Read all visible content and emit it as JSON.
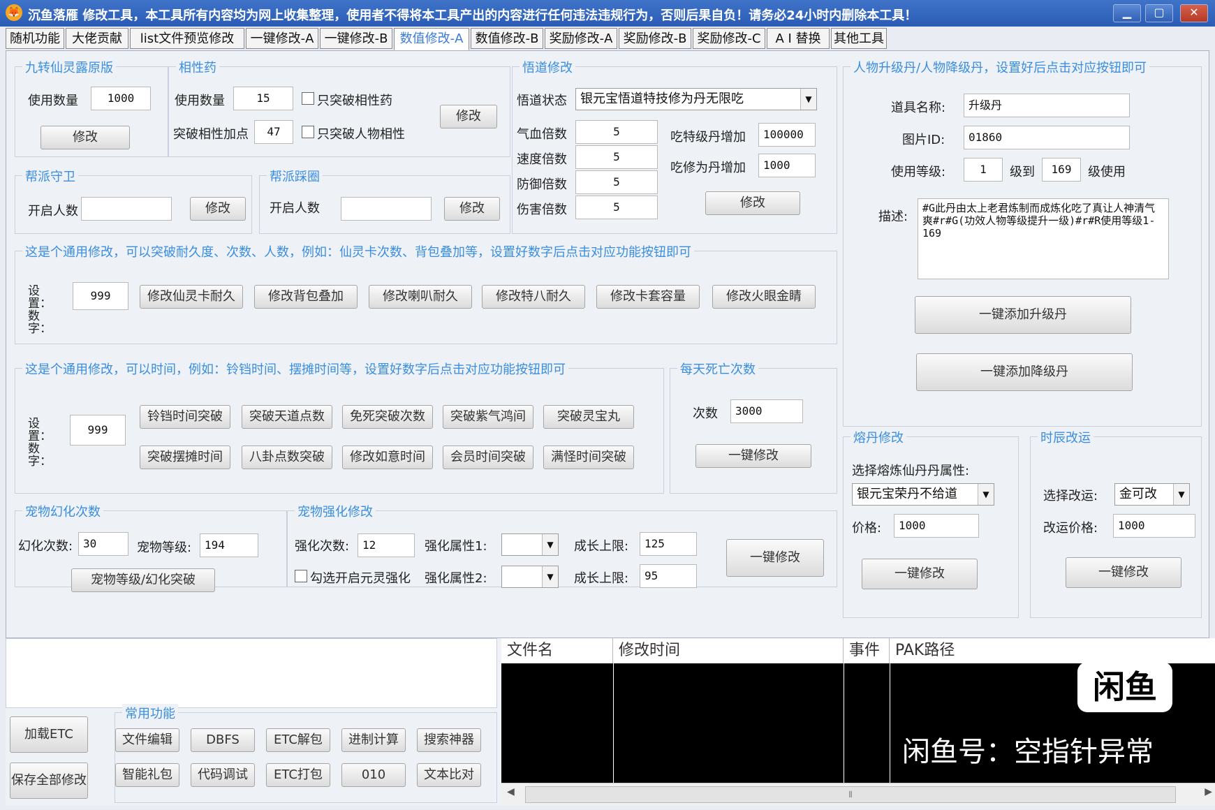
{
  "window": {
    "title": "沉鱼落雁  修改工具，本工具所有内容均为网上收集整理，使用者不得将本工具产出的内容进行任何违法违规行为，否则后果自负！请务必24小时内删除本工具！",
    "min": "▁",
    "max": "▢",
    "close": "✕"
  },
  "tabs": [
    "随机功能",
    "大佬贡献",
    "list文件预览修改",
    "一键修改-A",
    "一键修改-B",
    "数值修改-A",
    "数值修改-B",
    "奖励修改-A",
    "奖励修改-B",
    "奖励修改-C",
    "A I 替换",
    "其他工具"
  ],
  "g1": {
    "title": "九转仙灵露原版",
    "qty_label": "使用数量",
    "qty": "1000",
    "btn": "修改"
  },
  "g2": {
    "title": "相性药",
    "qty_label": "使用数量",
    "qty": "15",
    "chk1": "只突破相性药",
    "bonus_label": "突破相性加点",
    "bonus": "47",
    "chk2": "只突破人物相性",
    "btn": "修改"
  },
  "g3": {
    "title": "帮派守卫",
    "label": "开启人数",
    "value": "",
    "btn": "修改"
  },
  "g4": {
    "title": "帮派踩圈",
    "label": "开启人数",
    "value": "",
    "btn": "修改"
  },
  "g5": {
    "title": "悟道修改",
    "state_label": "悟道状态",
    "state": "银元宝悟道特技修为丹无限吃",
    "hp_label": "气血倍数",
    "hp": "5",
    "speed_label": "速度倍数",
    "speed": "5",
    "def_label": "防御倍数",
    "def": "5",
    "dmg_label": "伤害倍数",
    "dmg": "5",
    "tj_label": "吃特级丹增加",
    "tj": "100000",
    "xw_label": "吃修为丹增加",
    "xw": "1000",
    "btn": "修改"
  },
  "g6": {
    "title": "人物升级丹/人物降级丹，设置好后点击对应按钮即可",
    "name_label": "道具名称:",
    "name": "升级丹",
    "pic_label": "图片ID:",
    "pic": "01860",
    "lvl_label": "使用等级:",
    "lvl_from": "1",
    "to_label": "级到",
    "lvl_to": "169",
    "use_label": "级使用",
    "desc_label": "描述:",
    "desc": "#G此丹由太上老君炼制而成炼化吃了真让人神清气爽#r#G(功效人物等级提升一级)#r#R使用等级1-169",
    "btn_up": "一键添加升级丹",
    "btn_down": "一键添加降级丹"
  },
  "g7": {
    "title": "这是个通用修改，可以突破耐久度、次数、人数，例如：仙灵卡次数、背包叠加等，设置好数字后点击对应功能按钮即可",
    "set_label": "设置：数字：",
    "value": "999",
    "buttons": [
      "修改仙灵卡耐久",
      "修改背包叠加",
      "修改喇叭耐久",
      "修改特八耐久",
      "修改卡套容量",
      "修改火眼金睛"
    ]
  },
  "g8": {
    "title": "这是个通用修改，可以时间，例如：铃铛时间、摆摊时间等，设置好数字后点击对应功能按钮即可",
    "set_label": "设置：数字：",
    "value": "999",
    "buttons": [
      "铃铛时间突破",
      "突破天道点数",
      "免死突破次数",
      "突破紫气鸿间",
      "突破灵宝丸",
      "突破摆摊时间",
      "八卦点数突破",
      "修改如意时间",
      "会员时间突破",
      "满怪时间突破"
    ]
  },
  "g9": {
    "title": "每天死亡次数",
    "label": "次数",
    "value": "3000",
    "btn": "一键修改"
  },
  "g10": {
    "title": "熔丹修改",
    "sel_label": "选择熔炼仙丹丹属性:",
    "sel": "银元宝荣丹不给道",
    "price_label": "价格:",
    "price": "1000",
    "btn": "一键修改"
  },
  "g11": {
    "title": "时辰改运",
    "sel_label": "选择改运:",
    "sel": "金可改",
    "price_label": "改运价格:",
    "price": "1000",
    "btn": "一键修改"
  },
  "g12": {
    "title": "宠物幻化次数",
    "count_label": "幻化次数:",
    "count": "30",
    "lvl_label": "宠物等级:",
    "lvl": "194",
    "btn": "宠物等级/幻化突破"
  },
  "g13": {
    "title": "宠物强化修改",
    "times_label": "强化次数:",
    "times": "12",
    "chk": "勾选开启元灵强化",
    "attr1_label": "强化属性1:",
    "attr2_label": "强化属性2:",
    "grow1_label": "成长上限:",
    "grow1": "125",
    "grow2_label": "成长上限:",
    "grow2": "95",
    "btn": "一键修改"
  },
  "common": {
    "title": "常用功能",
    "load": "加载ETC",
    "save": "保存全部修改",
    "buttons": [
      "文件编辑",
      "DBFS",
      "ETC解包",
      "进制计算",
      "搜索神器",
      "智能礼包",
      "代码调试",
      "ETC打包",
      "010",
      "文本比对"
    ]
  },
  "table": {
    "headers": [
      "文件名",
      "修改时间",
      "事件",
      "PAK路径"
    ]
  },
  "watermark": {
    "logo": "闲鱼",
    "text": "闲鱼号：空指针异常"
  }
}
